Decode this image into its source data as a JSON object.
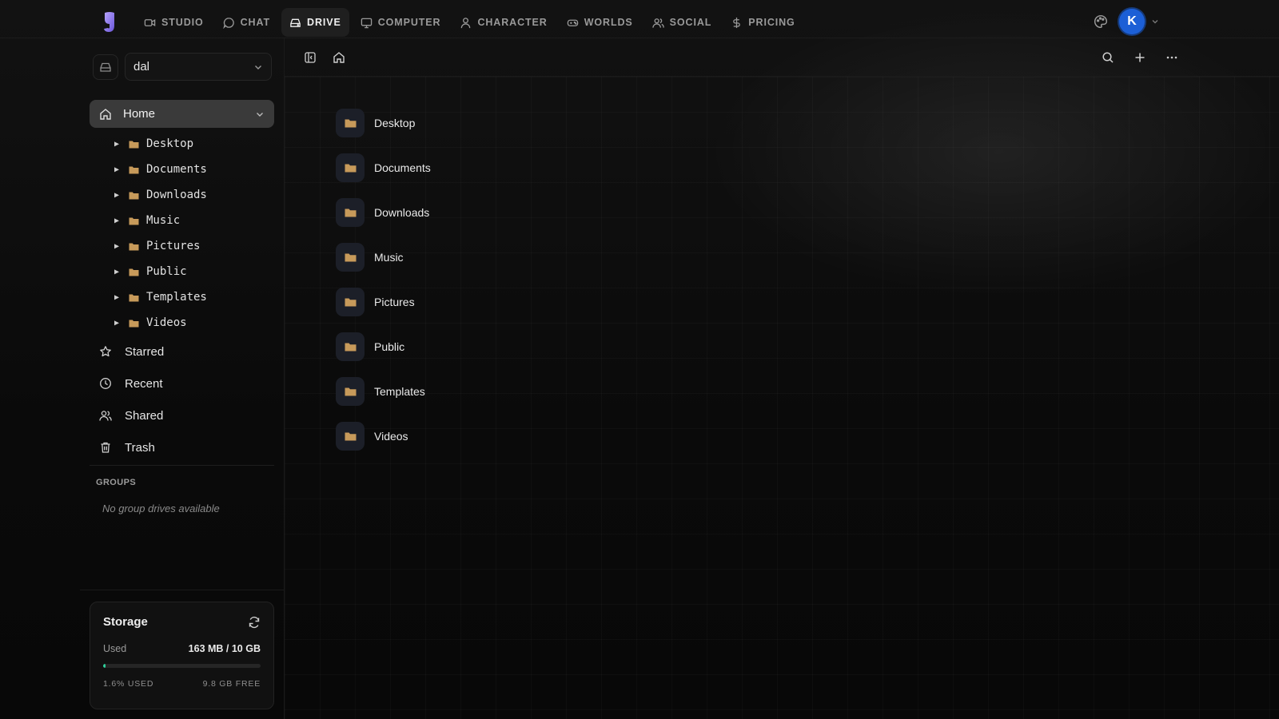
{
  "nav": {
    "items": [
      {
        "label": "STUDIO",
        "icon": "video-icon"
      },
      {
        "label": "CHAT",
        "icon": "chat-bubble-icon"
      },
      {
        "label": "DRIVE",
        "icon": "drive-icon",
        "active": true
      },
      {
        "label": "COMPUTER",
        "icon": "monitor-icon"
      },
      {
        "label": "CHARACTER",
        "icon": "user-icon"
      },
      {
        "label": "WORLDS",
        "icon": "gamepad-icon"
      },
      {
        "label": "SOCIAL",
        "icon": "users-icon"
      },
      {
        "label": "PRICING",
        "icon": "dollar-icon"
      }
    ],
    "avatar_initial": "K"
  },
  "sidebar": {
    "drive_name": "dal",
    "home_label": "Home",
    "tree": [
      "Desktop",
      "Documents",
      "Downloads",
      "Music",
      "Pictures",
      "Public",
      "Templates",
      "Videos"
    ],
    "links": [
      {
        "label": "Starred",
        "icon": "star-icon"
      },
      {
        "label": "Recent",
        "icon": "clock-icon"
      },
      {
        "label": "Shared",
        "icon": "users-icon"
      },
      {
        "label": "Trash",
        "icon": "trash-icon"
      }
    ],
    "groups_title": "GROUPS",
    "groups_empty": "No group drives available"
  },
  "storage": {
    "title": "Storage",
    "used_label": "Used",
    "used_value": "163 MB / 10 GB",
    "used_fraction": 0.016,
    "percent_label": "1.6% USED",
    "free_label": "9.8 GB FREE"
  },
  "files": [
    "Desktop",
    "Documents",
    "Downloads",
    "Music",
    "Pictures",
    "Public",
    "Templates",
    "Videos"
  ],
  "colors": {
    "accent_avatar": "#1c5fd6",
    "folder": "#c79a5a",
    "storage_bar": "#2ecf9a",
    "active_row": "#3a3a3a"
  }
}
